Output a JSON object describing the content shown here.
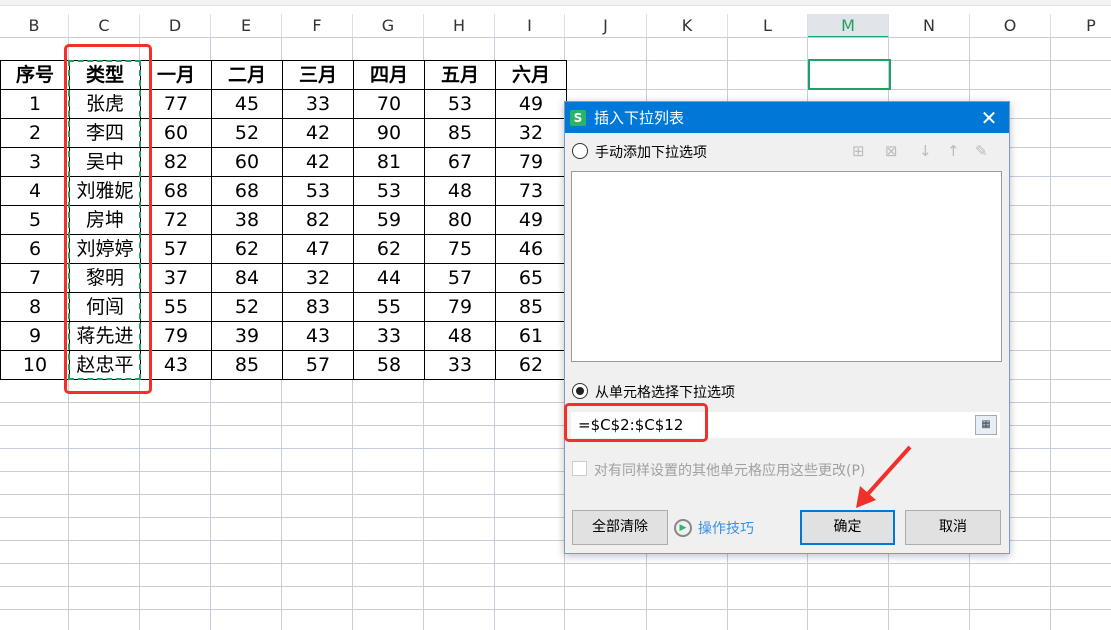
{
  "columns": [
    "B",
    "C",
    "D",
    "E",
    "F",
    "G",
    "H",
    "I",
    "J",
    "K",
    "L",
    "M",
    "N",
    "O",
    "P"
  ],
  "table": {
    "headers": [
      "序号",
      "类型",
      "一月",
      "二月",
      "三月",
      "四月",
      "五月",
      "六月"
    ],
    "rows": [
      [
        "1",
        "张虎",
        "77",
        "45",
        "33",
        "70",
        "53",
        "49"
      ],
      [
        "2",
        "李四",
        "60",
        "52",
        "42",
        "90",
        "85",
        "32"
      ],
      [
        "3",
        "吴中",
        "82",
        "60",
        "42",
        "81",
        "67",
        "79"
      ],
      [
        "4",
        "刘雅妮",
        "68",
        "68",
        "53",
        "53",
        "48",
        "73"
      ],
      [
        "5",
        "房坤",
        "72",
        "38",
        "82",
        "59",
        "80",
        "49"
      ],
      [
        "6",
        "刘婷婷",
        "57",
        "62",
        "47",
        "62",
        "75",
        "46"
      ],
      [
        "7",
        "黎明",
        "37",
        "84",
        "32",
        "44",
        "57",
        "65"
      ],
      [
        "8",
        "何闯",
        "55",
        "52",
        "83",
        "55",
        "79",
        "85"
      ],
      [
        "9",
        "蒋先进",
        "79",
        "39",
        "43",
        "33",
        "48",
        "61"
      ],
      [
        "10",
        "赵忠平",
        "43",
        "85",
        "57",
        "58",
        "33",
        "62"
      ]
    ]
  },
  "dialog": {
    "title": "插入下拉列表",
    "logo": "S",
    "manual_option": "手动添加下拉选项",
    "cell_option": "从单元格选择下拉选项",
    "range_value": "=$C$2:$C$12",
    "apply_all": "对有同样设置的其他单元格应用这些更改(P)",
    "clear_all": "全部清除",
    "tips": "操作技巧",
    "ok": "确定",
    "cancel": "取消"
  },
  "colors": {
    "accent": "#0078d7",
    "highlight": "#f0302a",
    "selection": "#1fa065"
  }
}
